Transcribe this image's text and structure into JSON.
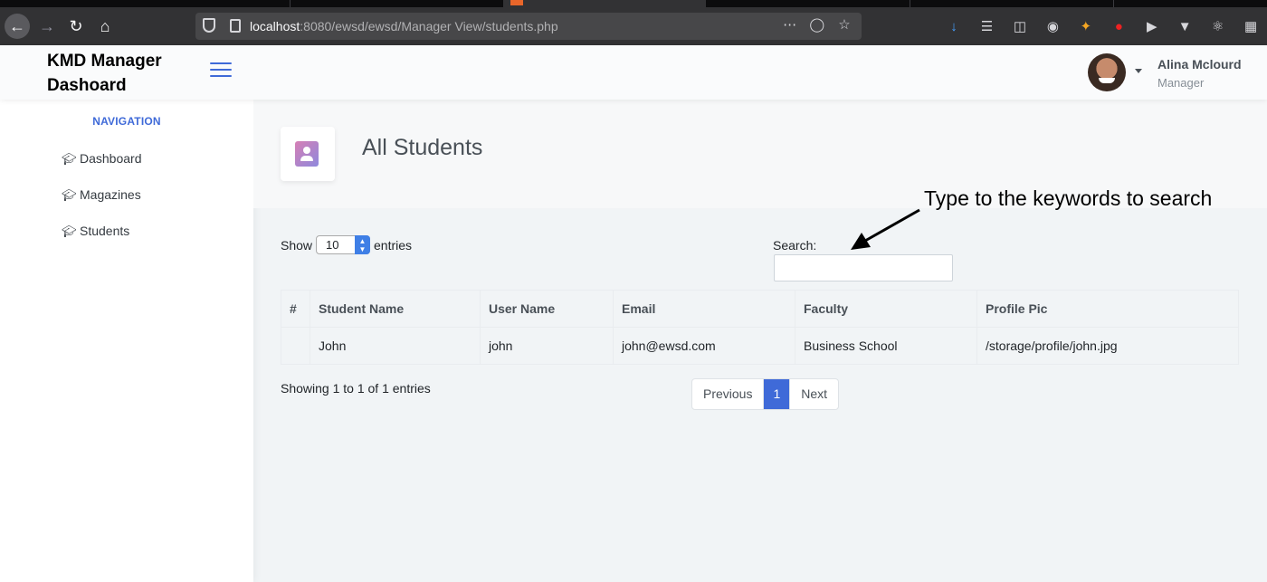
{
  "browser": {
    "url_host": "localhost",
    "url_rest": ":8080/ewsd/ewsd/Manager View/students.php"
  },
  "header": {
    "brand": "KMD Manager Dashoard",
    "user_name": "Alina Mclourd",
    "user_role": "Manager"
  },
  "sidebar": {
    "heading": "NAVIGATION",
    "items": [
      {
        "label": "Dashboard"
      },
      {
        "label": "Magazines"
      },
      {
        "label": "Students"
      }
    ]
  },
  "page": {
    "title": "All Students",
    "annotation": "Type to the keywords to search"
  },
  "datatable": {
    "show_label": "Show",
    "entries_label": "entries",
    "page_length": "10",
    "search_label": "Search:",
    "search_value": "",
    "columns": [
      "#",
      "Student Name",
      "User Name",
      "Email",
      "Faculty",
      "Profile Pic"
    ],
    "rows": [
      {
        "num": "",
        "student_name": "John",
        "user_name": "john",
        "email": "john@ewsd.com",
        "faculty": "Business School",
        "profile_pic": "/storage/profile/john.jpg"
      }
    ],
    "info": "Showing 1 to 1 of 1 entries",
    "pagination": {
      "previous": "Previous",
      "current": "1",
      "next": "Next"
    }
  },
  "colors": {
    "accent": "#3f6ad8",
    "background": "#f1f4f6"
  }
}
